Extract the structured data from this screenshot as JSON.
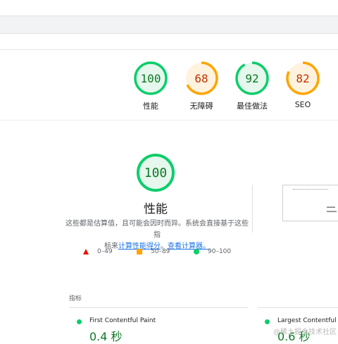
{
  "summary_gauges": [
    {
      "score": "100",
      "label": "性能",
      "color": "#0cce6b",
      "text_color": "#0d7a26",
      "bg": "#e6f7ed",
      "fraction": 1.0
    },
    {
      "score": "68",
      "label": "无障碍",
      "color": "#ffa400",
      "text_color": "#c33300",
      "bg": "#fff3e0",
      "fraction": 0.68
    },
    {
      "score": "92",
      "label": "最佳做法",
      "color": "#0cce6b",
      "text_color": "#0d7a26",
      "bg": "#e6f7ed",
      "fraction": 0.92
    },
    {
      "score": "82",
      "label": "SEO",
      "color": "#ffa400",
      "text_color": "#c33300",
      "bg": "#fff3e0",
      "fraction": 0.82
    }
  ],
  "performance": {
    "score": "100",
    "title": "性能",
    "desc_line1": "这些都是估算值，且可能会因时而异。系统会直接基于这些指",
    "desc_line2_prefix": "标来",
    "link1": "计算性能得分",
    "desc_sep": "。",
    "link2": "查看计算器。"
  },
  "legend": [
    {
      "range": "0–49",
      "shape": "triangle",
      "color": "#eb0f00"
    },
    {
      "range": "50–89",
      "shape": "square",
      "color": "#ffa400"
    },
    {
      "range": "90–100",
      "shape": "circle",
      "color": "#0cce6b"
    }
  ],
  "metrics": {
    "label": "指标",
    "items": [
      {
        "name": "First Contentful Paint",
        "value": "0.4 秒"
      },
      {
        "name": "Largest Contentful P",
        "value": "0.6 秒"
      }
    ]
  },
  "watermark": "@稀土掘金技术社区"
}
